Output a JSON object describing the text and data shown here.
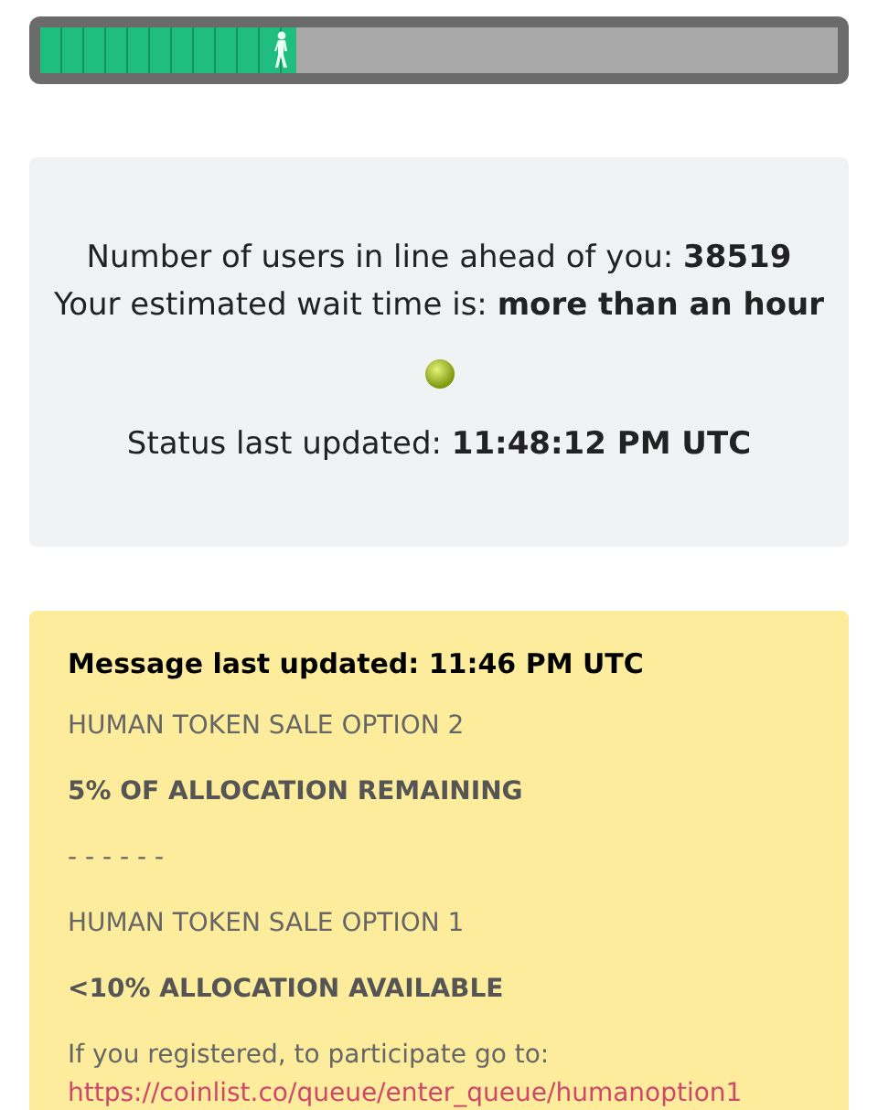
{
  "progress": {
    "level": 0.32
  },
  "status": {
    "lines": [
      "Number of users in line ahead of you: **38519**",
      "Your estimated wait time is: **more than an hour**"
    ],
    "updated": "Status last updated: **11:48:12 PM UTC**"
  },
  "message": {
    "items": [
      {
        "kind": "title",
        "text": "Message last updated: 11:46 PM UTC"
      },
      {
        "kind": "plain",
        "text": "HUMAN TOKEN SALE OPTION 2"
      },
      {
        "kind": "strong",
        "text": "5% OF ALLOCATION REMAINING"
      },
      {
        "kind": "plain",
        "text": "- - - - - -"
      },
      {
        "kind": "plain",
        "text": "HUMAN TOKEN SALE OPTION 1"
      },
      {
        "kind": "strong",
        "text": "<10% ALLOCATION AVAILABLE"
      },
      {
        "kind": "plain",
        "text": "If you registered, to participate go to:"
      },
      {
        "kind": "link",
        "text": "https://coinlist.co/queue/enter_queue/humanoption1"
      }
    ]
  }
}
